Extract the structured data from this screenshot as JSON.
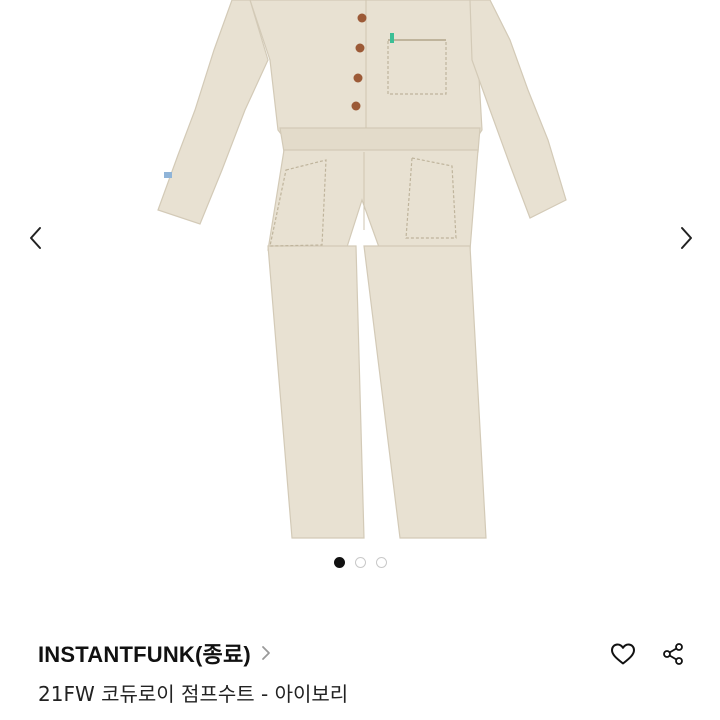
{
  "product": {
    "brand": "INSTANTFUNK(종료)",
    "title": "21FW 코듀로이 점프수트 - 아이보리",
    "image_alt": "jumpsuit-photo"
  },
  "gallery": {
    "total_images": 3,
    "active_index": 1
  },
  "icons": {
    "prev": "chevron-left-icon",
    "next": "chevron-right-icon",
    "brand_link": "chevron-right-icon",
    "like": "heart-icon",
    "share": "share-icon"
  },
  "colors": {
    "garment": "#e7e0d0",
    "dot_active": "#111111",
    "dot_inactive": "#c9c9c9"
  }
}
